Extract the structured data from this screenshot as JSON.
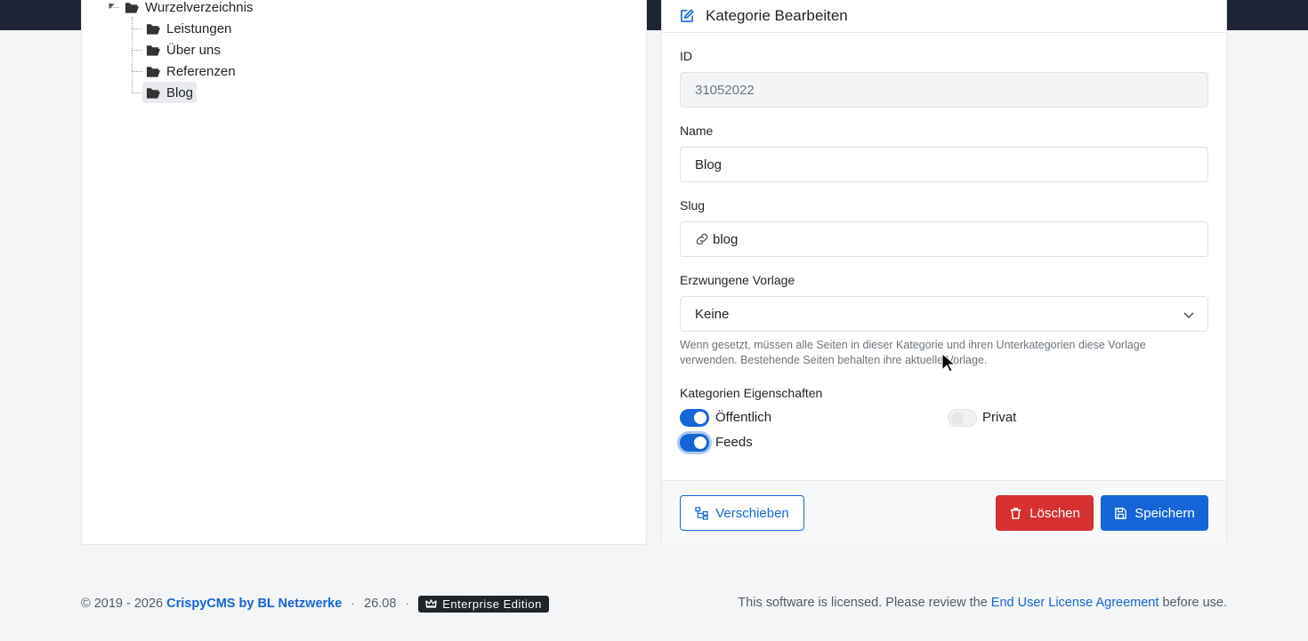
{
  "tree": {
    "root": "Wurzelverzeichnis",
    "children": [
      "Leistungen",
      "Über uns",
      "Referenzen",
      "Blog"
    ],
    "selected": "Blog"
  },
  "form": {
    "title": "Kategorie Bearbeiten",
    "id_label": "ID",
    "id_value": "31052022",
    "name_label": "Name",
    "name_value": "Blog",
    "slug_label": "Slug",
    "slug_value": "blog",
    "template_label": "Erzwungene Vorlage",
    "template_value": "Keine",
    "template_help": "Wenn gesetzt, müssen alle Seiten in dieser Kategorie und ihren Unterkategorien diese Vorlage verwenden. Bestehende Seiten behalten ihre aktuelle Vorlage.",
    "properties_label": "Kategorien Eigenschaften",
    "toggles": {
      "public": {
        "label": "Öffentlich",
        "on": true
      },
      "private": {
        "label": "Privat",
        "on": false
      },
      "feeds": {
        "label": "Feeds",
        "on": true
      }
    },
    "buttons": {
      "move": "Verschieben",
      "delete": "Löschen",
      "save": "Speichern"
    }
  },
  "footer": {
    "copyright": "© 2019 - 2026",
    "brand": "CrispyCMS by BL Netzwerke",
    "version": "26.08",
    "edition": "Enterprise Edition",
    "license_prefix": "This software is licensed. Please review the",
    "license_link": "End User License Agreement",
    "license_suffix": "before use."
  },
  "colors": {
    "primary": "#1565d8",
    "danger": "#d63031",
    "topbar": "#1e2436"
  }
}
